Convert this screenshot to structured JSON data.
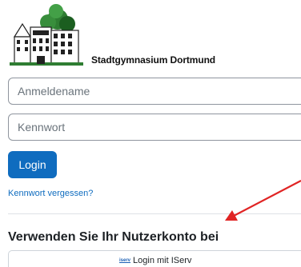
{
  "logo": {
    "text": "Stadtgymnasium Dortmund",
    "icon": "school-building-with-tree-icon"
  },
  "form": {
    "username_placeholder": "Anmeldename",
    "password_placeholder": "Kennwort",
    "login_label": "Login",
    "forgot_label": "Kennwort vergessen?"
  },
  "external": {
    "heading": "Verwenden Sie Ihr Nutzerkonto bei",
    "iserv_logo": "iserv",
    "iserv_label": "Login mit IServ"
  },
  "colors": {
    "accent": "#0f6cbf",
    "arrow": "#e02424"
  }
}
